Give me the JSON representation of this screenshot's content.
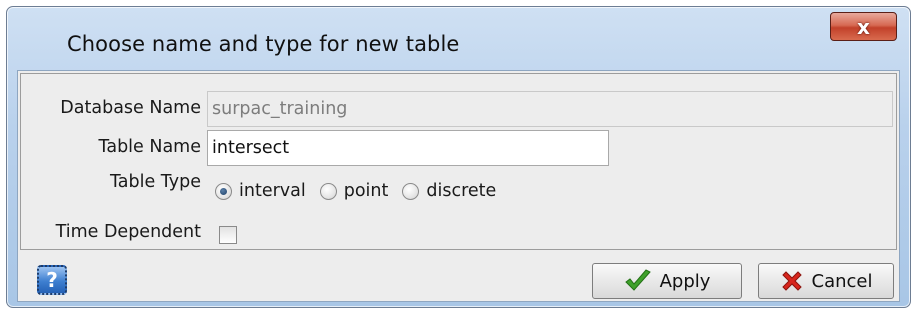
{
  "dialog": {
    "title": "Choose name and type for new table",
    "close_label": "x"
  },
  "form": {
    "database_name": {
      "label": "Database Name",
      "value": "surpac_training"
    },
    "table_name": {
      "label": "Table Name",
      "value": "intersect"
    },
    "table_type": {
      "label": "Table Type",
      "options": [
        "interval",
        "point",
        "discrete"
      ],
      "selected": "interval"
    },
    "time_dependent": {
      "label": "Time Dependent",
      "checked": false
    }
  },
  "buttons": {
    "help_label": "?",
    "apply_label": "Apply",
    "cancel_label": "Cancel"
  },
  "icons": {
    "apply": "checkmark-icon",
    "cancel": "red-x-icon",
    "help": "question-icon"
  },
  "colors": {
    "apply_icon": "#3fa12b",
    "cancel_icon": "#d8261d",
    "title_bar": "#b9d1ec",
    "close_button": "#c2412a"
  }
}
